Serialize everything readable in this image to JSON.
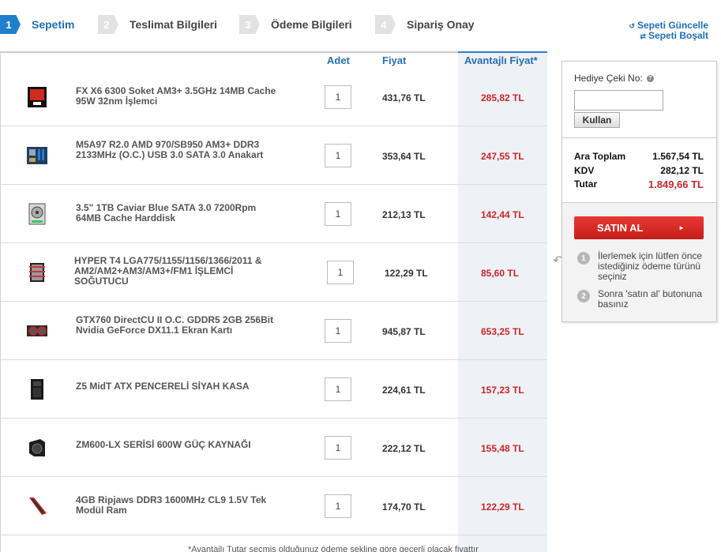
{
  "steps": [
    {
      "num": "1",
      "label": "Sepetim",
      "active": true
    },
    {
      "num": "2",
      "label": "Teslimat Bilgileri",
      "active": false
    },
    {
      "num": "3",
      "label": "Ödeme Bilgileri",
      "active": false
    },
    {
      "num": "4",
      "label": "Sipariş Onay",
      "active": false
    }
  ],
  "links": {
    "update": "Sepeti Güncelle",
    "empty": "Sepeti Boşalt"
  },
  "table": {
    "headers": {
      "qty": "Adet",
      "price": "Fiyat",
      "adv_price": "Avantajlı Fiyat*"
    },
    "items": [
      {
        "name": "FX X6 6300 Soket AM3+ 3.5GHz 14MB Cache 95W 32nm İşlemci",
        "qty": "1",
        "price": "431,76 TL",
        "adv_price": "285,82 TL",
        "icon": "cpu-box-icon"
      },
      {
        "name": "M5A97 R2.0 AMD 970/SB950 AM3+ DDR3 2133MHz (O.C.) USB 3.0 SATA 3.0 Anakart",
        "qty": "1",
        "price": "353,64 TL",
        "adv_price": "247,55 TL",
        "icon": "motherboard-icon"
      },
      {
        "name": "3.5\" 1TB Caviar Blue SATA 3.0 7200Rpm 64MB Cache Harddisk",
        "qty": "1",
        "price": "212,13 TL",
        "adv_price": "142,44 TL",
        "icon": "harddisk-icon"
      },
      {
        "name": "HYPER T4 LGA775/1155/1156/1366/2011 & AM2/AM2+AM3/AM3+/FM1 İŞLEMCİ SOĞUTUCU",
        "qty": "1",
        "price": "122,29 TL",
        "adv_price": "85,60 TL",
        "icon": "cpu-cooler-icon"
      },
      {
        "name": "GTX760 DirectCU II O.C. GDDR5 2GB 256Bit Nvidia GeForce DX11.1 Ekran Kartı",
        "qty": "1",
        "price": "945,87 TL",
        "adv_price": "653,25 TL",
        "icon": "graphics-card-icon"
      },
      {
        "name": "Z5 MidT ATX PENCERELİ SİYAH KASA",
        "qty": "1",
        "price": "224,61 TL",
        "adv_price": "157,23 TL",
        "icon": "pc-case-icon"
      },
      {
        "name": "ZM600-LX SERİSİ 600W GÜÇ KAYNAĞI",
        "qty": "1",
        "price": "222,12 TL",
        "adv_price": "155,48 TL",
        "icon": "power-supply-icon"
      },
      {
        "name": "4GB Ripjaws DDR3 1600MHz CL9 1.5V Tek Modül Ram",
        "qty": "1",
        "price": "174,70 TL",
        "adv_price": "122,29 TL",
        "icon": "ram-module-icon"
      }
    ],
    "footnote": "*Avantajlı Tutar seçmiş olduğunuz ödeme şekline göre geçerli olacak fiyattır"
  },
  "side": {
    "gift_label": "Hediye Çeki No:",
    "gift_value": "",
    "use_button": "Kullan",
    "subtotal_label": "Ara Toplam",
    "subtotal": "1.567,54 TL",
    "vat_label": "KDV",
    "vat": "282,12 TL",
    "total_label": "Tutar",
    "total": "1.849,66 TL",
    "buy_button": "SATIN AL",
    "hint1_num": "1",
    "hint1": "İlerlemek için lütfen önce istediğiniz ödeme türünü seçiniz",
    "hint2_num": "2",
    "hint2": "Sonra 'satın al' butonuna basınız"
  },
  "colors": {
    "accent": "#1f7fce",
    "price_red": "#c8262b",
    "buy_red": "#d9292a"
  }
}
